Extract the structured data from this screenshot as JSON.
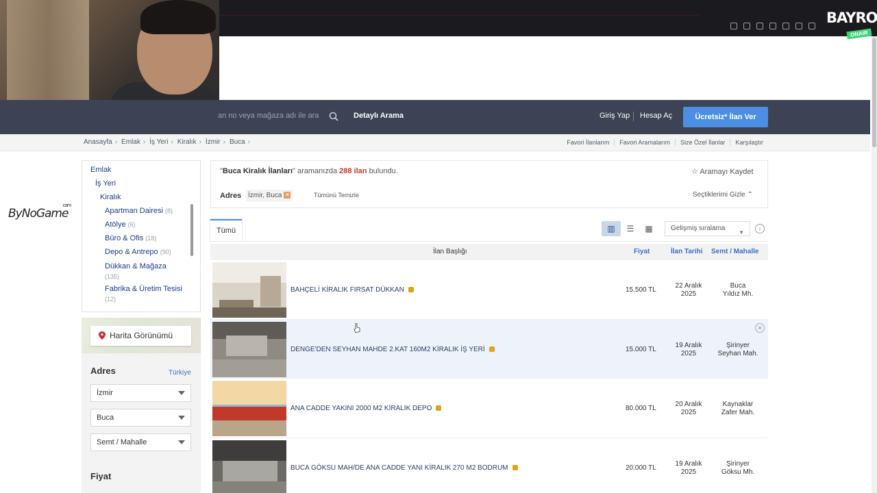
{
  "header": {
    "search_placeholder": "an no veya mağaza adı ile ara",
    "detailed_search": "Detaylı Arama",
    "login": "Giriş Yap",
    "register": "Hesap Aç",
    "post_ad": "Ücretsiz* İlan Ver"
  },
  "overlay": {
    "stream_logo": "BAYRO",
    "on_air": "ONAIR",
    "watermark": "ByNoGame",
    "watermark_sup": "com"
  },
  "breadcrumb": [
    "Anasayfa",
    "Emlak",
    "İş Yeri",
    "Kiralık",
    "İzmir",
    "Buca"
  ],
  "breadcrumb_links": [
    "Favori İlanlarım",
    "Favori Aramalarım",
    "Size Özel İlanlar",
    "Karşılaştır"
  ],
  "categories": {
    "root": "Emlak",
    "level1": "İş Yeri",
    "level2": "Kiralık",
    "items": [
      {
        "label": "Apartman Dairesi",
        "count": "(8)"
      },
      {
        "label": "Atölye",
        "count": "(6)"
      },
      {
        "label": "Büro & Ofis",
        "count": "(18)"
      },
      {
        "label": "Depo & Antrepo",
        "count": "(90)"
      },
      {
        "label": "Dükkan & Mağaza",
        "count": "(135)"
      },
      {
        "label": "Fabrika & Üretim Tesisi",
        "count": "(12)"
      }
    ]
  },
  "map_button": "Harita Görünümü",
  "filters": {
    "address_title": "Adres",
    "country_link": "Türkiye",
    "city": "İzmir",
    "district": "Buca",
    "neighborhood": "Semt / Mahalle",
    "price_title": "Fiyat"
  },
  "summary": {
    "query": "Buca Kiralık İlanları",
    "middle": "aramanızda",
    "count": "288 ilan",
    "suffix": "bulundu.",
    "save_search": "Aramayı Kaydet",
    "address_label": "Adres",
    "address_chip": "İzmir, Buca",
    "clear_all": "Tümünü Temizle",
    "hide_selected": "Seçtiklerimi Gizle"
  },
  "toolbar": {
    "tab_all": "Tümü",
    "sort": "Gelişmiş sıralama"
  },
  "table": {
    "headers": [
      "İlan Başlığı",
      "Fiyat",
      "İlan Tarihi",
      "Semt / Mahalle"
    ],
    "rows": [
      {
        "title": "BAHÇELİ KİRALIK FIRSAT DÜKKAN",
        "price": "15.500 TL",
        "date1": "22 Aralık",
        "date2": "2025",
        "loc1": "Buca",
        "loc2": "Yıldız Mh."
      },
      {
        "title": "DENGE'DEN SEYHAN MAHDE 2.KAT 160M2 KİRALIK İŞ YERİ",
        "price": "15.000 TL",
        "date1": "19 Aralık",
        "date2": "2025",
        "loc1": "Şirinyer",
        "loc2": "Seyhan Mah."
      },
      {
        "title": "ANA CADDE YAKINI 2000 M2 KİRALIK DEPO",
        "price": "80.000 TL",
        "date1": "20 Aralık",
        "date2": "2025",
        "loc1": "Kaynaklar",
        "loc2": "Zafer Mah."
      },
      {
        "title": "BUCA GÖKSU MAH/DE ANA CADDE YANI KİRALIK 270 M2 BODRUM",
        "price": "20.000 TL",
        "date1": "19 Aralık",
        "date2": "2025",
        "loc1": "Şirinyer",
        "loc2": "Göksu Mh."
      }
    ]
  },
  "colors": {
    "nav": "#3d4354",
    "accent": "#4a8fe4",
    "link": "#1e3a8a",
    "count_red": "#c0392b"
  }
}
